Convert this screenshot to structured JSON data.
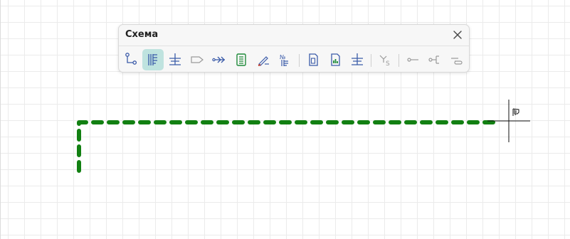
{
  "panel": {
    "title": "Схема",
    "close_icon": "close-icon"
  },
  "toolbar": {
    "tools": [
      {
        "icon": "wire-connection-icon",
        "active": false
      },
      {
        "icon": "multi-wire-bus-icon",
        "active": true
      },
      {
        "icon": "ground-symbol-icon",
        "active": false
      },
      {
        "icon": "label-tag-icon",
        "active": false,
        "disabled": true
      },
      {
        "icon": "wire-arrow-icon",
        "active": false
      },
      {
        "icon": "component-insert-icon",
        "active": false
      },
      {
        "icon": "pencil-edit-icon",
        "active": false
      },
      {
        "icon": "numbering-icon",
        "active": false,
        "text": "№"
      },
      {
        "icon": "document-icon",
        "active": false
      },
      {
        "icon": "report-chart-icon",
        "active": false
      },
      {
        "icon": "ground-terminal-icon",
        "active": false
      },
      {
        "icon": "cable-cross-section-icon",
        "active": false,
        "disabled": true
      },
      {
        "icon": "wire-end-icon",
        "active": false,
        "disabled": true
      },
      {
        "icon": "wire-terminal-icon",
        "active": false,
        "disabled": true
      },
      {
        "icon": "wire-loop-icon",
        "active": false,
        "disabled": true
      }
    ]
  },
  "drawing": {
    "line_color": "#128012",
    "cursor_icon": "crosshair-bus-cursor-icon"
  },
  "colors": {
    "accent_active": "#bfe3df",
    "icon_blue": "#3b5ba9",
    "icon_green": "#1f8a3a",
    "icon_disabled": "#9a9a9a"
  }
}
